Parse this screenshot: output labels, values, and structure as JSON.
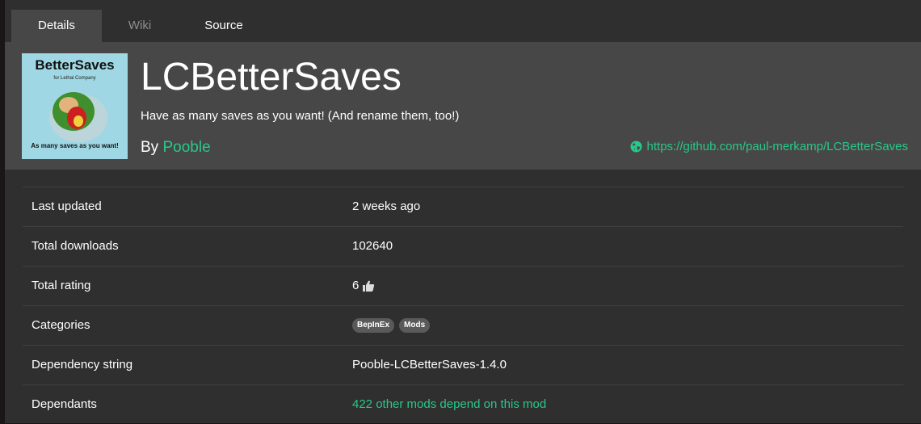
{
  "tabs": [
    {
      "label": "Details"
    },
    {
      "label": "Wiki"
    },
    {
      "label": "Source"
    }
  ],
  "package": {
    "logo_title": "BetterSaves",
    "logo_subtitle": "for Lethal Company",
    "logo_caption": "As many saves as you want!",
    "name": "LCBetterSaves",
    "description": "Have as many saves as you want! (And rename them, too!)",
    "by_prefix": "By",
    "author": "Pooble",
    "website": "https://github.com/paul-merkamp/LCBetterSaves"
  },
  "details": {
    "last_updated_label": "Last updated",
    "last_updated_value": "2 weeks ago",
    "total_downloads_label": "Total downloads",
    "total_downloads_value": "102640",
    "total_rating_label": "Total rating",
    "total_rating_value": "6",
    "categories_label": "Categories",
    "categories": [
      "BepInEx",
      "Mods"
    ],
    "dependency_string_label": "Dependency string",
    "dependency_string_value": "Pooble-LCBetterSaves-1.4.0",
    "dependants_label": "Dependants",
    "dependants_value": "422 other mods depend on this mod"
  },
  "colors": {
    "accent": "#28c88b",
    "background": "#2f2f2f",
    "header": "#474747"
  }
}
